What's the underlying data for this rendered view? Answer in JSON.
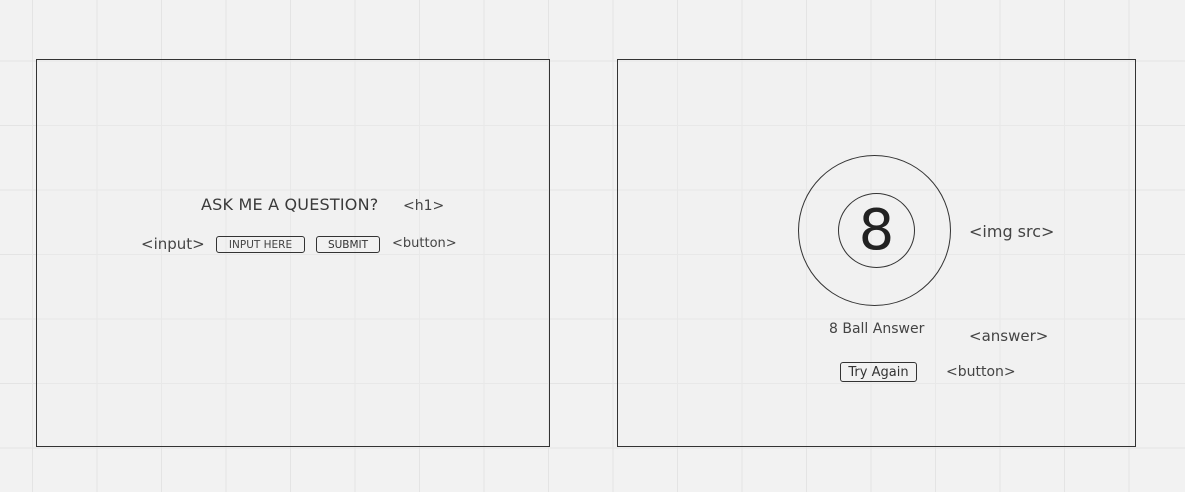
{
  "left_panel": {
    "heading": "ASK ME A QUESTION?",
    "heading_tag": "<h1>",
    "input_tag": "<input>",
    "input_placeholder": "INPUT HERE",
    "submit_label": "SUBMIT",
    "button_tag": "<button>"
  },
  "right_panel": {
    "ball_number": "8",
    "img_tag": "<img src>",
    "answer_text": "8 Ball Answer",
    "answer_tag": "<answer>",
    "try_again_label": "Try Again",
    "button_tag": "<button>"
  }
}
